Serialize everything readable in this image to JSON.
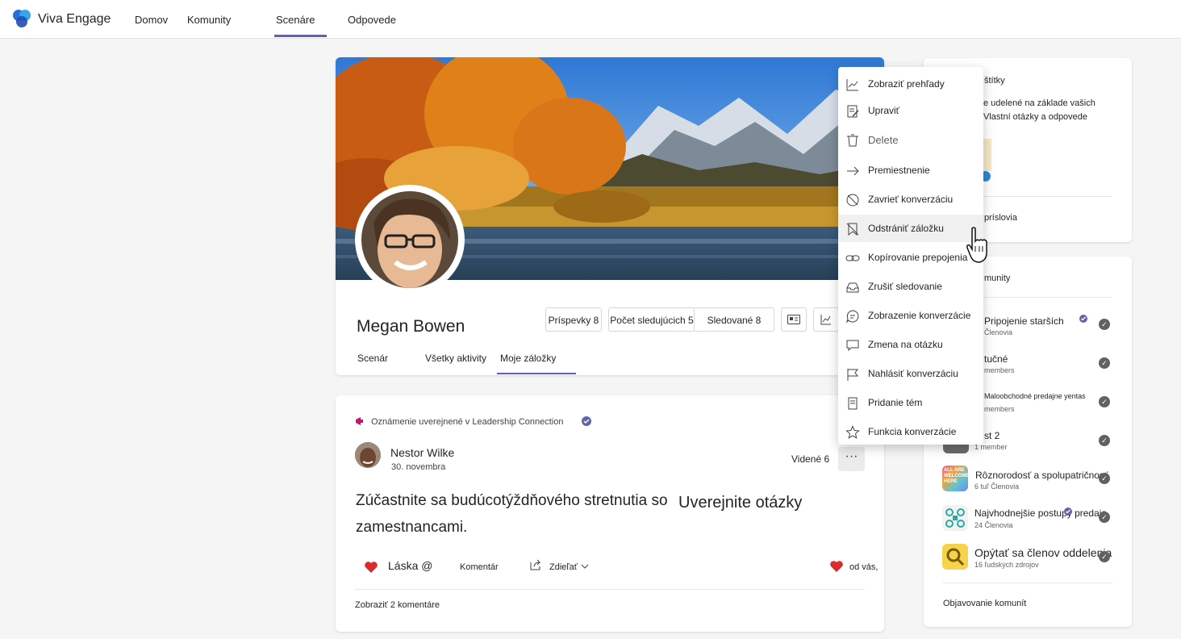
{
  "app": {
    "name": "Viva Engage"
  },
  "nav": {
    "items": [
      "Domov",
      "Komunity",
      "Scenáre",
      "Odpovede"
    ],
    "active": "Scenáre"
  },
  "profile": {
    "name": "Megan Bowen",
    "stats": {
      "posts": "Príspevky 8",
      "followers": "Počet sledujúcich 5",
      "following": "Sledované 8"
    },
    "tabs": [
      "Scenár",
      "Všetky aktivity",
      "Moje záložky"
    ],
    "active_tab": "Moje záložky"
  },
  "post": {
    "announcement": "Oznámenie uverejnené v Leadership Connection",
    "author": "Nestor Wilke",
    "date": "30. novembra",
    "seen": "Videné 6",
    "text_line1": "Zúčastnite sa budúcotýždňového stretnutia so",
    "text_line2": "zamestnancami.",
    "text_right": "Uverejnite otázky",
    "actions": {
      "love": "Láska @",
      "comment": "Komentár",
      "share": "Zdieľať",
      "reactions": "od vás,"
    },
    "show_comments": "Zobraziť 2 komentáre"
  },
  "rail": {
    "badges": {
      "title_fragment": "štítky",
      "text_line1": "e udelené na základe vašich",
      "text_line2": "Vlastní otázky a odpovede",
      "footer_fragment": "príslovia"
    },
    "communities": {
      "title_fragment": "munity",
      "items": [
        {
          "name": "Pripojenie starších",
          "sub": "Členovia"
        },
        {
          "name": "tučné",
          "sub": "members"
        },
        {
          "name": "Maloobchodné predajne yentas",
          "sub": "members"
        },
        {
          "name": "st 2",
          "sub": "1 member"
        },
        {
          "name": "Rôznorodosť a spolupatričnosť",
          "sub": "6 tuľ Členovia",
          "icon_text": "ALL ARE WELCOME HERE"
        },
        {
          "name": "Najvhodnejšie postupy predaja",
          "sub": "24 Členovia"
        },
        {
          "name": "Opýtať sa členov oddelenia",
          "sub": "16 ľudských zdrojov"
        }
      ],
      "discover": "Objavovanie komunít"
    }
  },
  "menu": {
    "items": [
      {
        "label": "Zobraziť prehľady",
        "icon": "chart-icon"
      },
      {
        "label": "Upraviť",
        "icon": "edit-icon"
      },
      {
        "label": "Delete",
        "icon": "trash-icon"
      },
      {
        "label": "Premiestnenie",
        "icon": "arrow-right-icon"
      },
      {
        "label": "Zavrieť konverzáciu",
        "icon": "chat-off-icon"
      },
      {
        "label": "Odstrániť záložku",
        "icon": "bookmark-off-icon"
      },
      {
        "label": "Kopírovanie prepojenia",
        "icon": "link-icon"
      },
      {
        "label": "Zrušiť sledovanie",
        "icon": "inbox-icon"
      },
      {
        "label": "Zobrazenie konverzácie",
        "icon": "chat-icon"
      },
      {
        "label": "Zmena na otázku",
        "icon": "question-chat-icon"
      },
      {
        "label": "Nahlásiť konverzáciu",
        "icon": "flag-icon"
      },
      {
        "label": "Pridanie tém",
        "icon": "document-icon"
      },
      {
        "label": "Funkcia konverzácie",
        "icon": "star-icon"
      }
    ]
  },
  "colors": {
    "accent": "#5b5fc7",
    "love": "#d92c2c"
  }
}
